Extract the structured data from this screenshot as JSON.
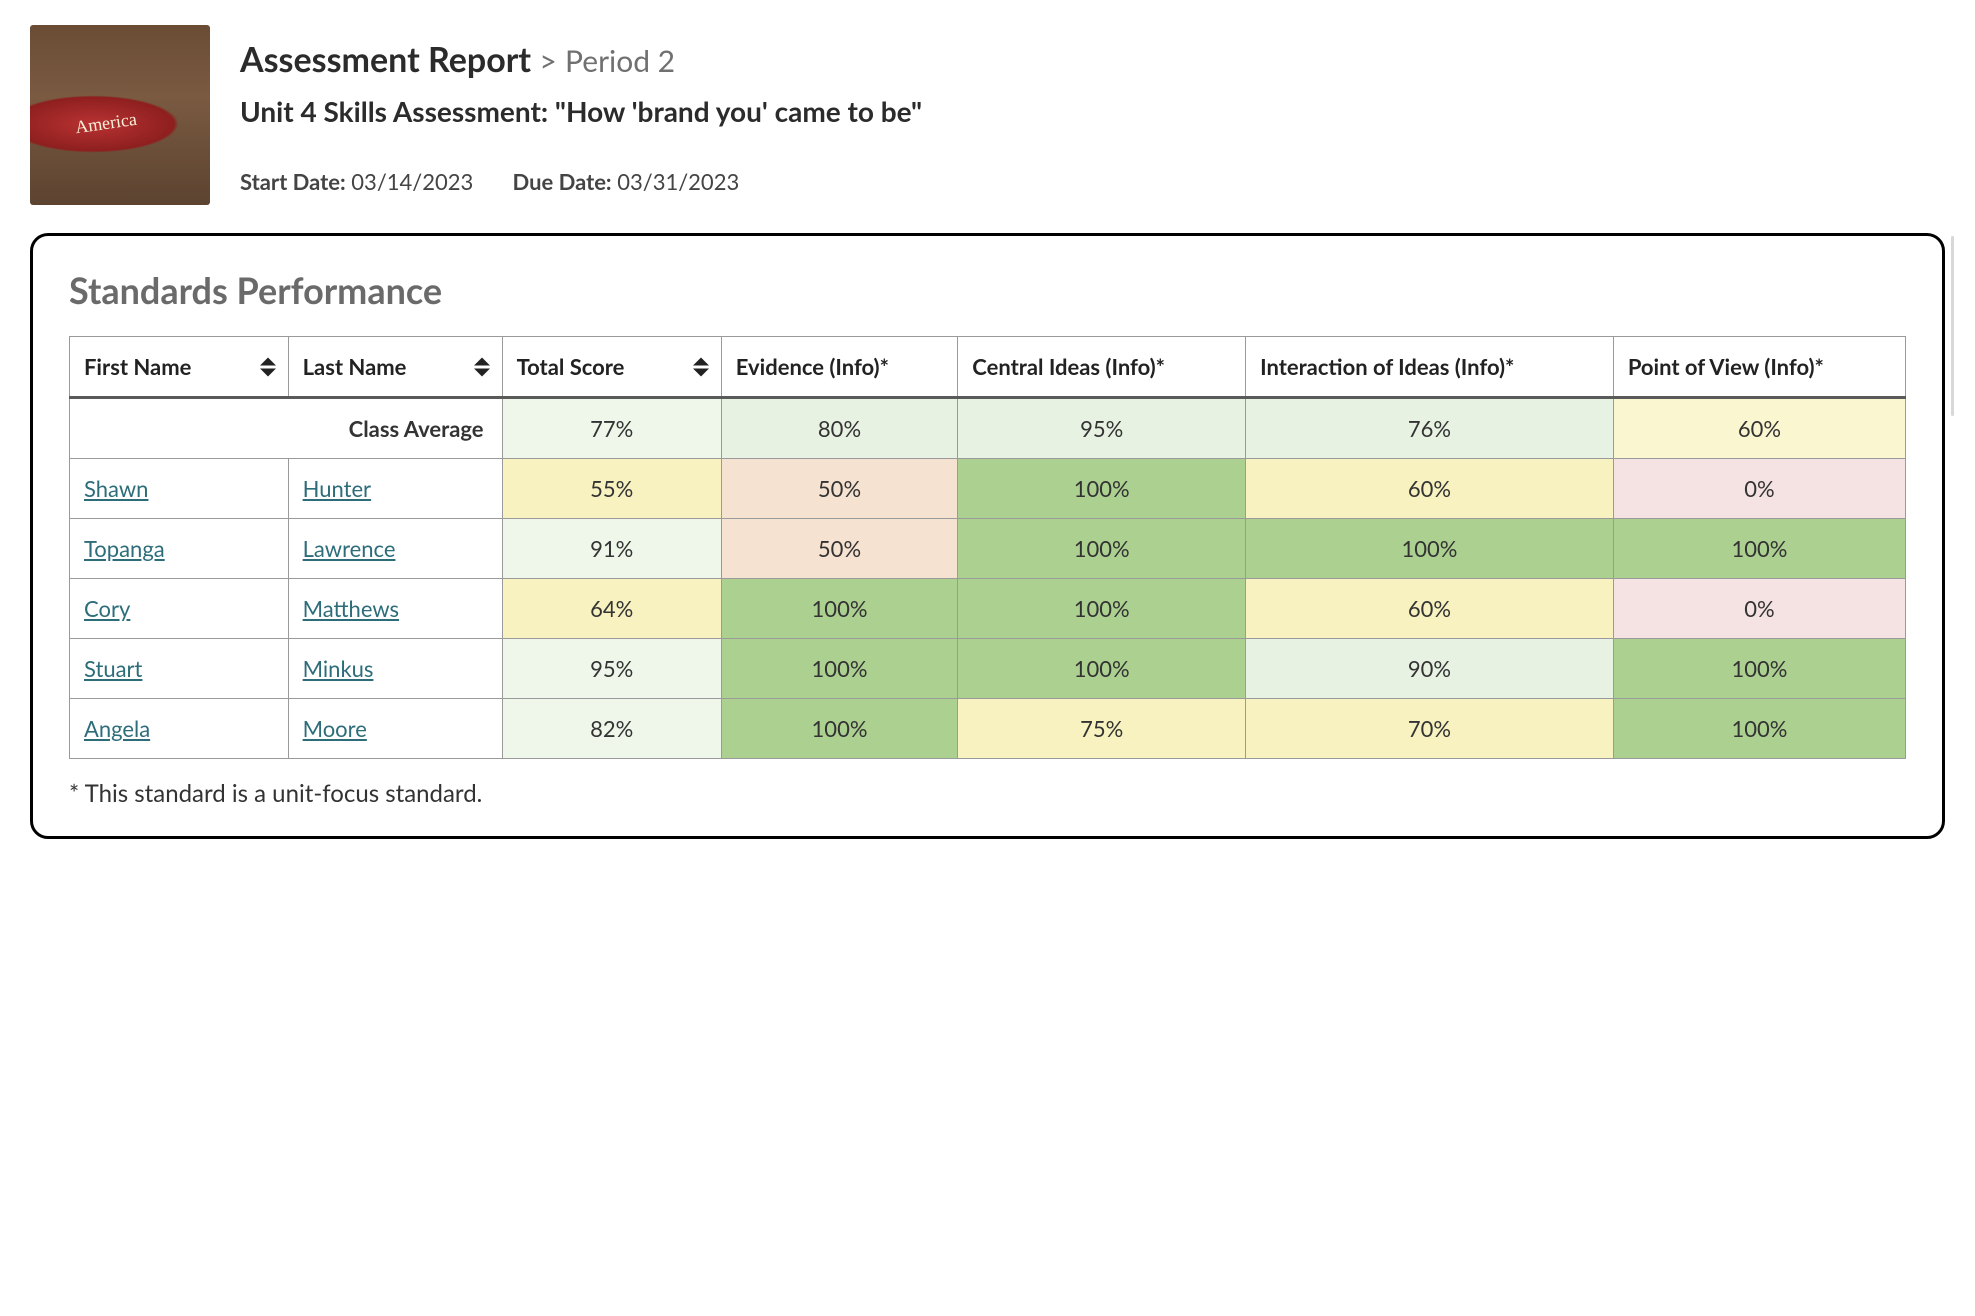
{
  "header": {
    "title": "Assessment Report",
    "crumb_sep": ">",
    "crumb": "Period 2",
    "subtitle": "Unit 4 Skills Assessment: \"How 'brand you' came to be\"",
    "start_label": "Start Date:",
    "start_value": "03/14/2023",
    "due_label": "Due Date:",
    "due_value": "03/31/2023",
    "thumb_alt": "can-on-dirt-image"
  },
  "panel": {
    "heading": "Standards Performance",
    "footnote": "* This standard is a unit-focus standard."
  },
  "columns": {
    "first_name": "First Name",
    "last_name": "Last Name",
    "total_score": "Total Score",
    "evidence": "Evidence (Info)*",
    "central_ideas": "Central Ideas (Info)*",
    "interaction": "Interaction of Ideas (Info)*",
    "pov": "Point of View (Info)*"
  },
  "class_average": {
    "label": "Class Average",
    "total": "77%",
    "evidence": "80%",
    "central": "95%",
    "interaction": "76%",
    "pov": "60%"
  },
  "rows": [
    {
      "first": "Shawn",
      "last": "Hunter",
      "total": "55%",
      "evidence": "50%",
      "central": "100%",
      "interaction": "60%",
      "pov": "0%"
    },
    {
      "first": "Topanga",
      "last": "Lawrence",
      "total": "91%",
      "evidence": "50%",
      "central": "100%",
      "interaction": "100%",
      "pov": "100%"
    },
    {
      "first": "Cory",
      "last": "Matthews",
      "total": "64%",
      "evidence": "100%",
      "central": "100%",
      "interaction": "60%",
      "pov": "0%"
    },
    {
      "first": "Stuart",
      "last": "Minkus",
      "total": "95%",
      "evidence": "100%",
      "central": "100%",
      "interaction": "90%",
      "pov": "100%"
    },
    {
      "first": "Angela",
      "last": "Moore",
      "total": "82%",
      "evidence": "100%",
      "central": "75%",
      "interaction": "70%",
      "pov": "100%"
    }
  ],
  "cell_colors": {
    "avg": {
      "total": "c-pgreen",
      "evidence": "c-lgreen",
      "central": "c-lgreen",
      "interaction": "c-lgreen",
      "pov": "c-lyellow"
    },
    "rows": [
      {
        "total": "c-yellow",
        "evidence": "c-orange",
        "central": "c-mgreen",
        "interaction": "c-yellow",
        "pov": "c-pink"
      },
      {
        "total": "c-pgreen",
        "evidence": "c-orange",
        "central": "c-mgreen",
        "interaction": "c-mgreen",
        "pov": "c-mgreen"
      },
      {
        "total": "c-yellow",
        "evidence": "c-mgreen",
        "central": "c-mgreen",
        "interaction": "c-yellow",
        "pov": "c-pink"
      },
      {
        "total": "c-pgreen",
        "evidence": "c-mgreen",
        "central": "c-mgreen",
        "interaction": "c-lgreen",
        "pov": "c-mgreen"
      },
      {
        "total": "c-pgreen",
        "evidence": "c-mgreen",
        "central": "c-yellow",
        "interaction": "c-yellow",
        "pov": "c-mgreen"
      }
    ]
  }
}
